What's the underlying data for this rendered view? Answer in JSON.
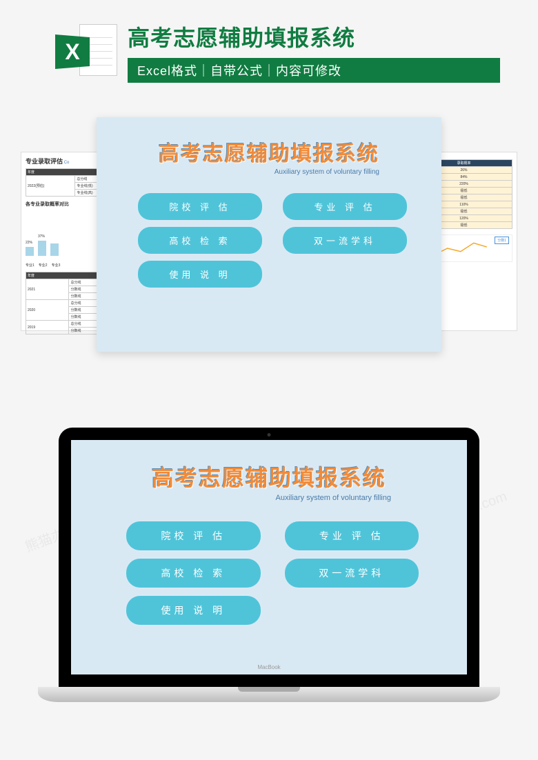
{
  "watermark": "熊猫办公 TUKUPPT.com",
  "header": {
    "excel_letter": "X",
    "title": "高考志愿辅助填报系统",
    "subtitle": "Excel格式｜自带公式｜内容可修改"
  },
  "card": {
    "title": "高考志愿辅助填报系统",
    "subtitle": "Auxiliary system of voluntary filling",
    "buttons": [
      "院校 评 估",
      "专业 评 估",
      "高校 检 索",
      "双一流学科",
      "使用 说 明"
    ]
  },
  "left_sheet": {
    "title": "专业录取评估",
    "co": "Co",
    "table_header": "年度",
    "year": "2022(预估)",
    "rows": [
      "总分线",
      "专业线(低)",
      "专业线(高)"
    ],
    "chart_title": "各专业录取概率对比",
    "bar_labels": [
      "专业1",
      "专业2",
      "专业3"
    ],
    "bottom_years": [
      "2021",
      "2020",
      "2019"
    ],
    "bottom_rows": [
      "总分线",
      "分数线",
      "分数线",
      "总分线",
      "分数线",
      "分数线",
      "总分线",
      "分数线"
    ]
  },
  "right_sheet": {
    "header_col": "录取概率",
    "values": [
      "26%",
      "84%",
      "220%",
      "极低",
      "极低",
      "110%",
      "极低",
      "120%",
      "极低"
    ],
    "legend": "分数1"
  },
  "laptop": {
    "label": "MacBook"
  },
  "chart_data": {
    "type": "bar",
    "title": "各专业录取概率对比",
    "categories": [
      "专业1",
      "专业2",
      "专业3"
    ],
    "values": [
      22,
      37,
      30
    ],
    "ylim": [
      0,
      50
    ]
  }
}
